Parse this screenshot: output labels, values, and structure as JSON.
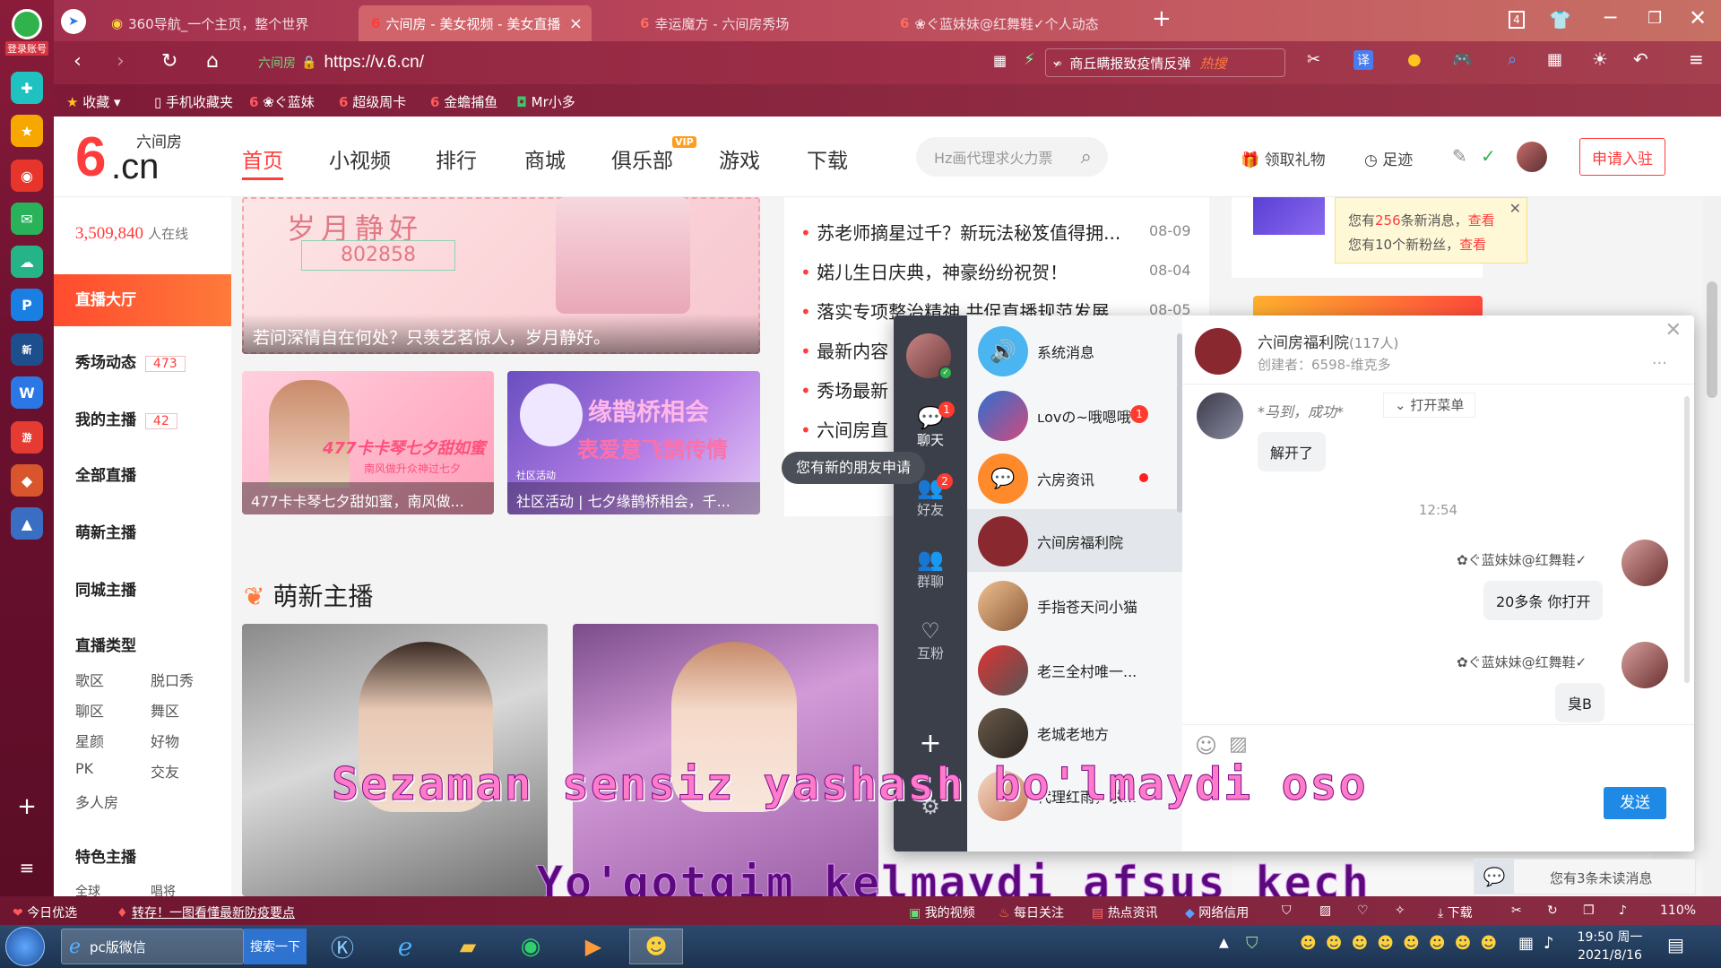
{
  "dock": {
    "login": "登录账号"
  },
  "tabs": [
    {
      "label": "360导航_一个主页，整个世界"
    },
    {
      "label": "六间房 - 美女视频 - 美女直播"
    },
    {
      "label": "幸运魔方 - 六间房秀场"
    },
    {
      "label": "❀ぐ蓝妹妹@红舞鞋✓个人动态"
    }
  ],
  "titlebar": {
    "tab_count": "4"
  },
  "address": {
    "site_name": "六间房",
    "url": "https://v.6.cn/",
    "search_text": "商丘瞒报致疫情反弹",
    "hot": "热搜"
  },
  "bookmarks": {
    "fav": "收藏",
    "mobile": "手机收藏夹",
    "b1": "❀ぐ蓝妹",
    "b2": "超级周卡",
    "b3": "金蟾捕鱼",
    "b4": "Mr小多"
  },
  "header": {
    "logo_top": "六间房",
    "logo_main": ".cn",
    "logo_six": "6",
    "nav": [
      "首页",
      "小视频",
      "排行",
      "商城",
      "俱乐部",
      "游戏",
      "下载"
    ],
    "vip": "VIP",
    "search_placeholder": "Hz画代理求火力票",
    "gift": "领取礼物",
    "footprint": "足迹",
    "join": "申请入驻"
  },
  "sidebar": {
    "online_count": "3,509,840",
    "online_label": "人在线",
    "hall": "直播大厅",
    "show": "秀场动态",
    "show_badge": "473",
    "my": "我的主播",
    "my_badge": "42",
    "all": "全部直播",
    "cute": "萌新主播",
    "city": "同城主播",
    "types": "直播类型",
    "type_items": [
      "歌区",
      "脱口秀",
      "聊区",
      "舞区",
      "星颜",
      "好物",
      "PK",
      "交友",
      "多人房"
    ],
    "feature": "特色主播",
    "more_a": "全球",
    "more_b": "唱将"
  },
  "banner": {
    "poem": "岁月静好",
    "code": "802858",
    "caption": "若问深情自在何处？只羡艺茗惊人，岁月静好。"
  },
  "promos": [
    {
      "caption": "477卡卡琴七夕甜如蜜，南风做..."
    },
    {
      "caption": "社区活动 | 七夕缘鹊桥相会，千..."
    }
  ],
  "promo_art": {
    "a1": "477卡卡琴七夕甜如蜜",
    "a2": "南风做升众神过七夕",
    "b1": "缘鹊桥相会",
    "b2": "表爱意飞鹊传情",
    "b3": "社区活动"
  },
  "news": [
    {
      "title": "苏老师摘星过千？新玩法秘笈值得拥...",
      "date": "08-09"
    },
    {
      "title": "婼儿生日庆典，神豪纷纷祝贺！",
      "date": "08-04"
    },
    {
      "title": "落实专项整治精神 共促直播规范发展",
      "date": "08-05"
    },
    {
      "title": "最新内容"
    },
    {
      "title": "秀场最新"
    },
    {
      "title": "六间房直"
    }
  ],
  "notice": {
    "line1_a": "您有",
    "line1_n": "256",
    "line1_b": "条新消息，",
    "line1_link": "查看",
    "line2_a": "您有10个新粉丝，",
    "line2_link": "查看"
  },
  "section": {
    "title": "萌新主播"
  },
  "friend_tip": "您有新的朋友申请",
  "chat": {
    "rail": [
      {
        "label": "聊天",
        "badge": "1"
      },
      {
        "label": "好友",
        "badge": "2"
      },
      {
        "label": "群聊"
      },
      {
        "label": "互粉"
      }
    ],
    "convs": [
      {
        "name": "系统消息"
      },
      {
        "name": "ʟovの~哦嗯哦",
        "badge": "1"
      },
      {
        "name": "六房资讯"
      },
      {
        "name": "六间房福利院"
      },
      {
        "name": "手指苍天问小猫"
      },
      {
        "name": "老三全村唯一..."
      },
      {
        "name": "老城老地方"
      },
      {
        "name": "代理红雨，求..."
      }
    ],
    "group_name": "六间房福利院",
    "group_count": "(117人)",
    "creator": "创建者：6598-维克多",
    "open_menu": "打开菜单",
    "msg1": "*马到，成功*",
    "msg2": "解开了",
    "time": "12:54",
    "sender": "✿ぐ蓝妹妹@红舞鞋✓",
    "msg3": "20多条 你打开",
    "msg4": "臭B",
    "send": "发送",
    "dots": "..."
  },
  "unread": "您有3条未读消息",
  "lyrics": {
    "line1": "Sezaman sensiz yashash bo'lmaydi oso",
    "line2": "Yo'qotgim kelmaydi afsus kech"
  },
  "statusbar": {
    "today": "今日优选",
    "news": "转存！一图看懂最新防疫要点",
    "my_video": "我的视频",
    "daily": "每日关注",
    "hot": "热点资讯",
    "credit": "网络信用",
    "download": "下载",
    "zoom": "110%"
  },
  "taskbar": {
    "wechat": "pc版微信",
    "search": "搜索一下",
    "time": "19:50 周一",
    "date": "2021/8/16"
  },
  "colors": {
    "brand": "#ff3c3c",
    "accent": "#e8431f",
    "send": "#1e8ae6"
  }
}
